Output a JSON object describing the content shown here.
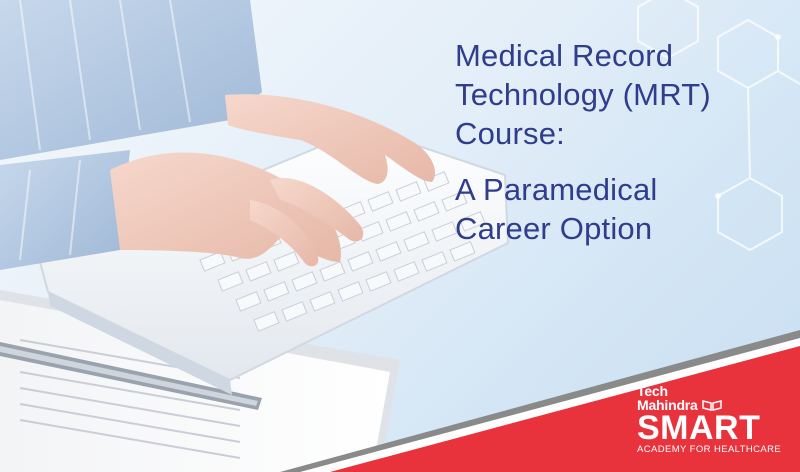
{
  "headline": {
    "line1": "Medical Record",
    "line2": "Technology (MRT)",
    "line3": "Course:",
    "line4": "A Paramedical",
    "line5": "Career Option"
  },
  "brand": {
    "tech": "Tech",
    "mahindra": "Mahindra",
    "smart": "SMART",
    "tagline": "ACADEMY FOR HEALTHCARE"
  },
  "colors": {
    "title": "#2f3d8c",
    "brand_red": "#e8323c",
    "stripe_gray": "#8a8a8a"
  }
}
